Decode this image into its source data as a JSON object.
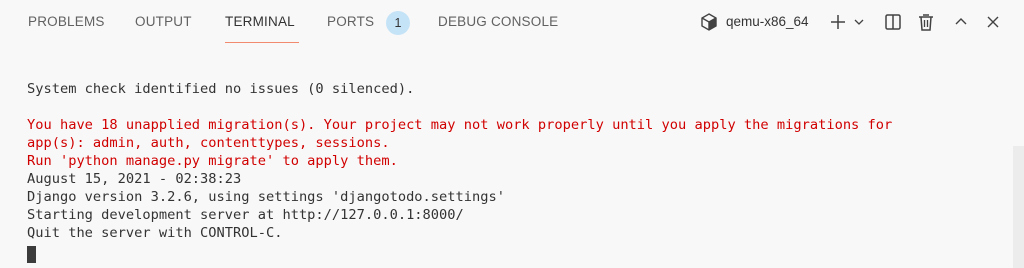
{
  "tabs": [
    {
      "label": "PROBLEMS"
    },
    {
      "label": "OUTPUT"
    },
    {
      "label": "TERMINAL",
      "active": true
    },
    {
      "label": "PORTS",
      "badge": "1"
    },
    {
      "label": "DEBUG CONSOLE"
    }
  ],
  "header_actions": {
    "shell_label": "qemu-x86_64",
    "icons": [
      "terminal-shell-icon",
      "plus-icon",
      "chevron-down-icon",
      "split-terminal-icon",
      "trash-icon",
      "chevron-up-icon",
      "close-icon"
    ]
  },
  "terminal": {
    "lines": [
      {
        "text": "System check identified no issues (0 silenced).",
        "type": "normal"
      },
      {
        "text": "",
        "type": "normal"
      },
      {
        "text": "You have 18 unapplied migration(s). Your project may not work properly until you apply the migrations for",
        "type": "error"
      },
      {
        "text": "app(s): admin, auth, contenttypes, sessions.",
        "type": "error"
      },
      {
        "text": "Run 'python manage.py migrate' to apply them.",
        "type": "error"
      },
      {
        "text": "August 15, 2021 - 02:38:23",
        "type": "normal"
      },
      {
        "text": "Django version 3.2.6, using settings 'djangotodo.settings'",
        "type": "normal"
      },
      {
        "text": "Starting development server at http://127.0.0.1:8000/",
        "type": "normal"
      },
      {
        "text": "Quit the server with CONTROL-C.",
        "type": "normal"
      }
    ]
  },
  "colors": {
    "background": "#f8f8f8",
    "text": "#333333",
    "error": "#d10000",
    "active_tab_underline": "#f28b6e",
    "badge": "#c5e3f7"
  }
}
